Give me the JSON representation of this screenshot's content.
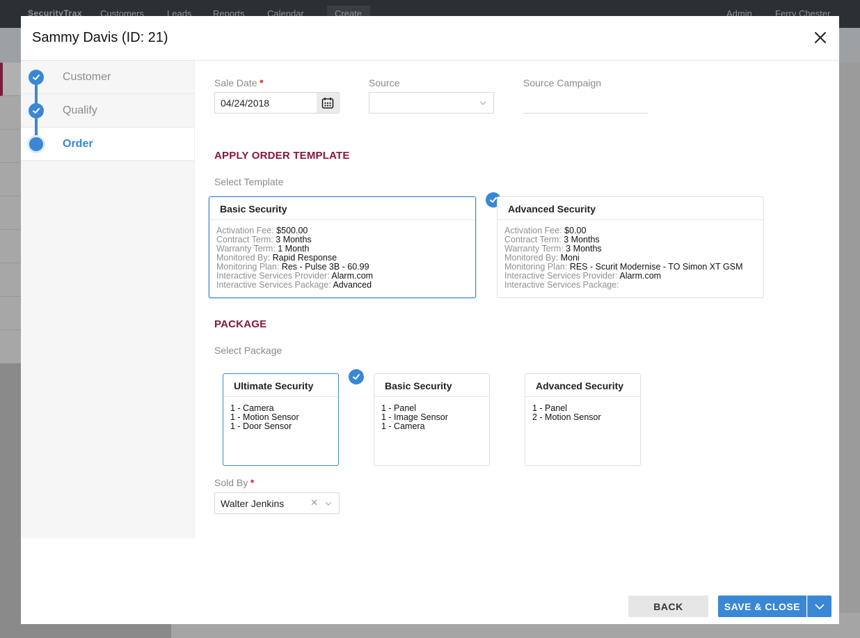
{
  "background": {
    "logo": "SecurityTrax",
    "nav": [
      "Customers",
      "Leads",
      "Reports",
      "Calendar",
      "Create"
    ],
    "right_nav": [
      "Admin",
      "Ferry Chester"
    ]
  },
  "modal": {
    "title": "Sammy Davis (ID: 21)"
  },
  "steps": [
    {
      "label": "Customer",
      "state": "complete"
    },
    {
      "label": "Qualify",
      "state": "complete"
    },
    {
      "label": "Order",
      "state": "active"
    }
  ],
  "form": {
    "sale_date_label": "Sale Date",
    "sale_date_value": "04/24/2018",
    "source_label": "Source",
    "source_value": "",
    "source_campaign_label": "Source Campaign",
    "source_campaign_value": ""
  },
  "order_template": {
    "section_title": "APPLY ORDER TEMPLATE",
    "select_label": "Select Template",
    "field_labels": {
      "activation_fee": "Activation Fee:",
      "contract_term": "Contract Term:",
      "warranty_term": "Warranty Term:",
      "monitored_by": "Monitored By:",
      "monitoring_plan": "Monitoring Plan:",
      "isp": "Interactive Services Provider:",
      "isp_package": "Interactive Services Package:"
    },
    "templates": [
      {
        "name": "Basic Security",
        "selected": true,
        "activation_fee": "$500.00",
        "contract_term": "3 Months",
        "warranty_term": "1 Month",
        "monitored_by": "Rapid Response",
        "monitoring_plan": "Res - Pulse 3B - 60.99",
        "isp": "Alarm.com",
        "isp_package": "Advanced"
      },
      {
        "name": "Advanced Security",
        "selected": false,
        "activation_fee": "$0.00",
        "contract_term": "3 Months",
        "warranty_term": "3 Months",
        "monitored_by": "Moni",
        "monitoring_plan": "RES - Scurit Modernise - TO Simon XT GSM",
        "isp": "Alarm.com",
        "isp_package": ""
      }
    ]
  },
  "package": {
    "section_title": "PACKAGE",
    "select_label": "Select Package",
    "packages": [
      {
        "name": "Ultimate Security",
        "selected": true,
        "items": [
          "1 - Camera",
          "1 - Motion Sensor",
          "1 - Door Sensor"
        ]
      },
      {
        "name": "Basic Security",
        "selected": false,
        "items": [
          "1 - Panel",
          "1 - Image Sensor",
          "1 - Camera"
        ]
      },
      {
        "name": "Advanced Security",
        "selected": false,
        "items": [
          "1 - Panel",
          "2 - Motion Sensor"
        ]
      }
    ]
  },
  "sold_by": {
    "label": "Sold By",
    "value": "Walter Jenkins"
  },
  "footer": {
    "back_label": "BACK",
    "save_label": "SAVE & CLOSE"
  },
  "colors": {
    "accent": "#3a87d6",
    "section_title": "#8a1538",
    "required": "#e04c4c"
  }
}
